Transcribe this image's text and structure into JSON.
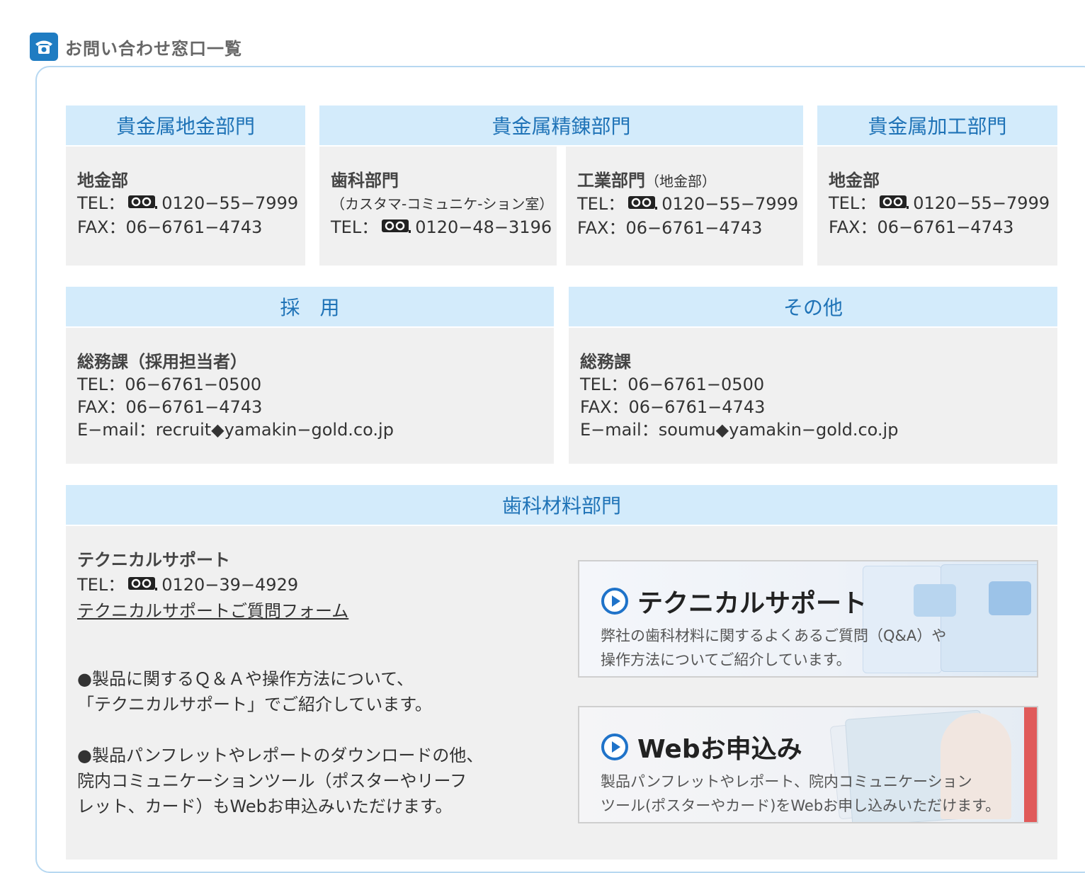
{
  "heading": {
    "title": "お問い合わせ窓口一覧",
    "icon": "phone-icon"
  },
  "colors": {
    "header_bg": "#d3ebfb",
    "header_text": "#1f73b7",
    "cell_bg": "#f0f0f0",
    "frame_border": "#b7d8f1",
    "icon_bg": "#1f7cc2"
  },
  "sections": {
    "jigane": {
      "title": "貴金属地金部門",
      "dept": "地金部",
      "tel_label": "TEL：",
      "tel": "0120−55−7999",
      "fax_label": "FAX：",
      "fax": "06−6761−4743"
    },
    "seiren": {
      "title": "貴金属精錬部門",
      "shika": {
        "dept": "歯科部門",
        "sub": "（カスタマ-コミュニケ-ション室）",
        "tel_label": "TEL：",
        "tel": "0120−48−3196"
      },
      "kogyo": {
        "dept": "工業部門",
        "sub": "（地金部）",
        "tel_label": "TEL：",
        "tel": "0120−55−7999",
        "fax_label": "FAX：",
        "fax": "06−6761−4743"
      }
    },
    "kako": {
      "title": "貴金属加工部門",
      "dept": "地金部",
      "tel_label": "TEL：",
      "tel": "0120−55−7999",
      "fax_label": "FAX：",
      "fax": "06−6761−4743"
    },
    "saiyo": {
      "title": "採　用",
      "dept": "総務課（採用担当者）",
      "tel": "TEL：06−6761−0500",
      "fax": "FAX：06−6761−4743",
      "email": "E−mail：recruit◆yamakin−gold.co.jp"
    },
    "sonota": {
      "title": "その他",
      "dept": "総務課",
      "tel": "TEL：06−6761−0500",
      "fax": "FAX：06−6761−4743",
      "email": "E−mail：soumu◆yamakin−gold.co.jp"
    },
    "shika_zairyo": {
      "title": "歯科材料部門",
      "dept": "テクニカルサポート",
      "tel_label": "TEL：",
      "tel": "0120−39−4929",
      "form_link": "テクニカルサポートご質問フォーム",
      "note1_line1": "●製品に関するＱ＆Ａや操作方法について、",
      "note1_line2": "「テクニカルサポート」でご紹介しています。",
      "note2_line1": "●製品パンフレットやレポートのダウンロードの他、",
      "note2_line2": "院内コミュニケーションツール（ポスターやリーフ",
      "note2_line3": "レット、カード）もWebお申込みいただけます。"
    }
  },
  "banners": {
    "support": {
      "title": "テクニカルサポート",
      "desc_line1": "弊社の歯科材料に関するよくあるご質問（Q&A）や",
      "desc_line2": "操作方法についてご紹介しています。"
    },
    "web": {
      "title": "Webお申込み",
      "desc_line1": "製品パンフレットやレポート、院内コミュニケーション",
      "desc_line2": "ツール(ポスターやカード)をWebお申し込みいただけます。"
    }
  }
}
